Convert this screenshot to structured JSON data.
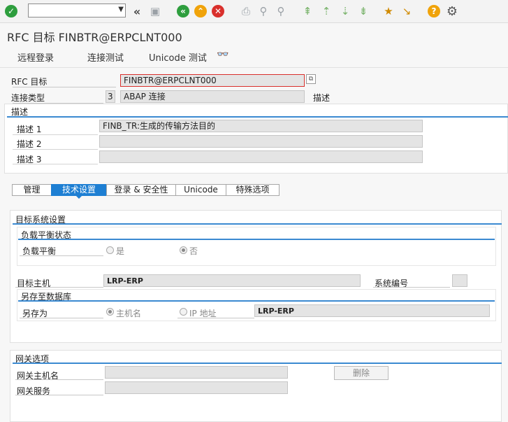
{
  "toolbar": {
    "command_value": ""
  },
  "title": "RFC 目标 FINBTR@ERPCLNT000",
  "appbar": {
    "remote_login": "远程登录",
    "connection_test": "连接测试",
    "unicode_test": "Unicode 测试"
  },
  "header": {
    "rfc_dest_label": "RFC 目标",
    "rfc_dest_value": "FINBTR@ERPCLNT000",
    "conn_type_label": "连接类型",
    "conn_type_code": "3",
    "conn_type_text": "ABAP 连接",
    "desc_short_label": "描述"
  },
  "description": {
    "section_title": "描述",
    "desc1_label": "描述 1",
    "desc1_value": "FINB_TR:生成的传输方法目的",
    "desc2_label": "描述 2",
    "desc2_value": "",
    "desc3_label": "描述 3",
    "desc3_value": ""
  },
  "tabs": [
    {
      "label": "管理",
      "active": false
    },
    {
      "label": "技术设置",
      "active": true
    },
    {
      "label": "登录 & 安全性",
      "active": false
    },
    {
      "label": "Unicode",
      "active": false
    },
    {
      "label": "特殊选项",
      "active": false
    }
  ],
  "target_system": {
    "section_title": "目标系统设置",
    "load_balance_group": "负载平衡状态",
    "load_balance_label": "负载平衡",
    "yes_label": "是",
    "no_label": "否",
    "load_balance_selected": "否",
    "target_host_label": "目标主机",
    "target_host_value": "LRP-ERP",
    "system_number_label": "系统编号",
    "system_number_value": "",
    "save_db_group": "另存至数据库",
    "save_as_label": "另存为",
    "hostname_label": "主机名",
    "ip_label": "IP 地址",
    "save_as_selected": "主机名",
    "save_as_value": "LRP-ERP"
  },
  "gateway": {
    "section_title": "网关选项",
    "host_label": "网关主机名",
    "host_value": "",
    "service_label": "网关服务",
    "service_value": "",
    "delete_button": "删除"
  },
  "colors": {
    "accent": "#1e7fd3",
    "section_line": "#3b8ad1",
    "ok_green": "#2e9e3e",
    "back_green": "#2e9e3e",
    "exit_orange": "#f0a30a",
    "cancel_red": "#d9302c",
    "help_yellow": "#f0a30a"
  }
}
